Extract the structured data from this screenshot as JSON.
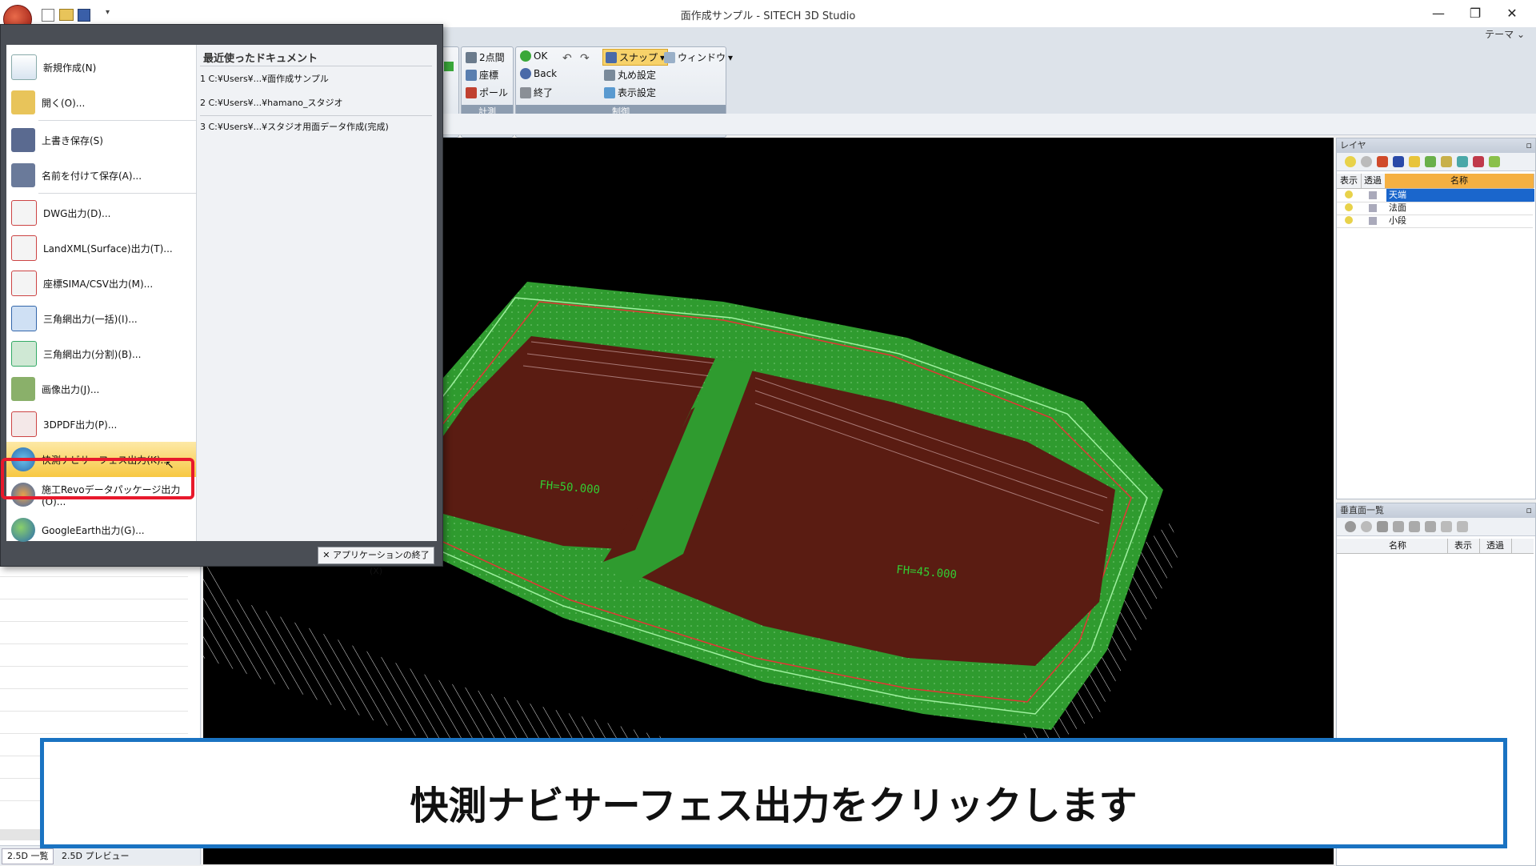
{
  "window": {
    "title": "面作成サンプル - SITECH 3D Studio",
    "theme_label": "テーマ"
  },
  "ribbon": {
    "measure_group": {
      "label": "計測",
      "items": [
        "2点間",
        "座標",
        "ポール"
      ]
    },
    "control_group": {
      "label": "制御",
      "ok": "OK",
      "back": "Back",
      "end": "終了",
      "snap": "スナップ",
      "round": "丸め設定",
      "display": "表示設定",
      "window": "ウィンドウ"
    }
  },
  "file_menu": {
    "items": [
      {
        "label": "新規作成(N)",
        "icon": "new-document-icon"
      },
      {
        "label": "開く(O)...",
        "icon": "open-folder-icon"
      },
      {
        "label": "上書き保存(S)",
        "icon": "save-icon"
      },
      {
        "label": "名前を付けて保存(A)...",
        "icon": "save-as-icon"
      },
      {
        "label": "DWG出力(D)...",
        "icon": "dwg-icon"
      },
      {
        "label": "LandXML(Surface)出力(T)...",
        "icon": "landxml-icon"
      },
      {
        "label": "座標SIMA/CSV出力(M)...",
        "icon": "sima-icon"
      },
      {
        "label": "三角網出力(一括)(I)...",
        "icon": "triangle-mesh-icon"
      },
      {
        "label": "三角網出力(分割)(B)...",
        "icon": "triangle-split-icon"
      },
      {
        "label": "画像出力(J)...",
        "icon": "image-export-icon"
      },
      {
        "label": "3DPDF出力(P)...",
        "icon": "pdf-icon"
      },
      {
        "label": "快測ナビサーフェス出力(K)...",
        "icon": "navi-surface-icon"
      },
      {
        "label": "施工Revoデータパッケージ出力(O)...",
        "icon": "revo-package-icon"
      },
      {
        "label": "GoogleEarth出力(G)...",
        "icon": "globe-icon"
      }
    ],
    "recent_title": "最近使ったドキュメント",
    "recent": [
      "1 C:¥Users¥...¥面作成サンプル",
      "2 C:¥Users¥...¥hamano_スタジオ",
      "3 C:¥Users¥...¥スタジオ用面データ作成(完成)"
    ],
    "exit_label": "アプリケーションの終了(X)"
  },
  "viewport": {
    "labels": [
      "FH=50.000",
      "FH=45.000"
    ]
  },
  "layer_panel": {
    "title": "レイヤ",
    "columns": [
      "表示",
      "透過",
      "名称"
    ],
    "rows": [
      "天端",
      "法面",
      "小段"
    ]
  },
  "section_panel": {
    "title": "垂直面一覧",
    "columns": [
      "名称",
      "表示",
      "透過"
    ]
  },
  "bottom_tabs": [
    "2.5D 一覧",
    "2.5D プレビュー"
  ],
  "caption": "快測ナビサーフェス出力をクリックします",
  "colors": {
    "surface_green": "#2f9b2f",
    "pad_brown": "#5a1c12",
    "highlight_red": "#e8192c",
    "caption_border": "#1a73c2"
  }
}
